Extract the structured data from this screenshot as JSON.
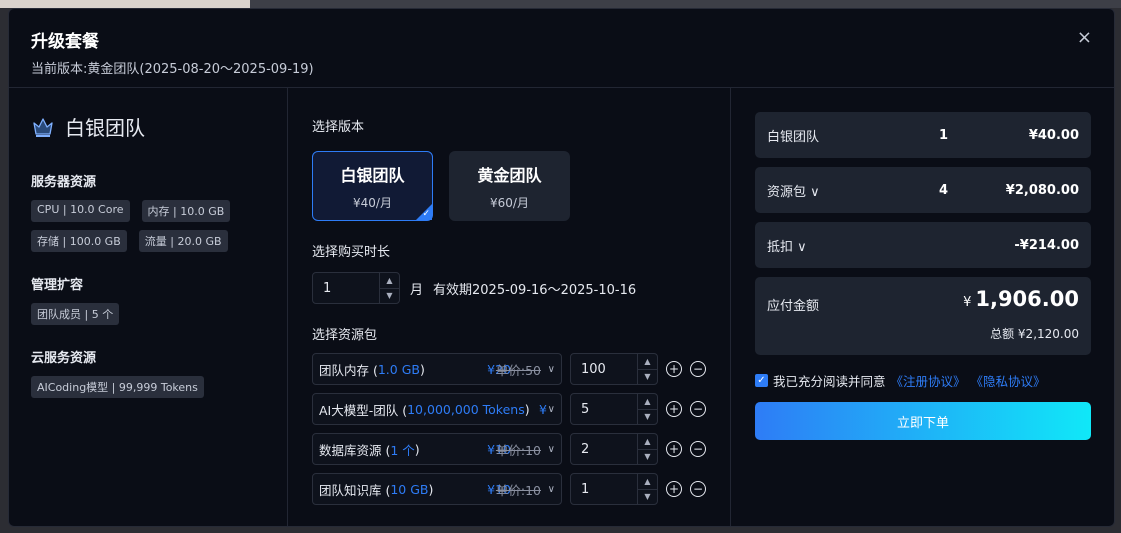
{
  "modal": {
    "title": "升级套餐",
    "subtitle": "当前版本:黄金团队(2025-08-20～2025-09-19)",
    "close_icon": "×"
  },
  "plan": {
    "name": "白银团队",
    "icon": "crown-icon",
    "sections": [
      {
        "title": "服务器资源",
        "tags": [
          "CPU | 10.0 Core",
          "内存 | 10.0 GB",
          "存储 | 100.0 GB",
          "流量 | 20.0 GB"
        ]
      },
      {
        "title": "管理扩容",
        "tags": [
          "团队成员 | 5 个"
        ]
      },
      {
        "title": "云服务资源",
        "tags": [
          "AICoding模型 | 99,999 Tokens"
        ]
      }
    ]
  },
  "version": {
    "label": "选择版本",
    "options": [
      {
        "name": "白银团队",
        "price": "¥40/月",
        "selected": true
      },
      {
        "name": "黄金团队",
        "price": "¥60/月",
        "selected": false
      }
    ]
  },
  "duration": {
    "label": "选择购买时长",
    "value": "1",
    "unit": "月",
    "validity": "有效期2025-09-16～2025-10-16"
  },
  "resources": {
    "label": "选择资源包",
    "items": [
      {
        "name": "团队内存 (",
        "spec": "1.0 GB",
        "close": ")",
        "price": "¥20",
        "old": "单价:50",
        "qty": "100"
      },
      {
        "name": "AI大模型-团队 (",
        "spec": "10,000,000 Tokens",
        "close": ")",
        "price": "¥",
        "old": "",
        "qty": "5"
      },
      {
        "name": "数据库资源 (",
        "spec": "1 个",
        "close": ")",
        "price": "¥10",
        "old": "单价:10",
        "qty": "2"
      },
      {
        "name": "团队知识库 (",
        "spec": "10 GB",
        "close": ")",
        "price": "¥10",
        "old": "单价:10",
        "qty": "1"
      }
    ]
  },
  "summary": {
    "rows": [
      {
        "label": "白银团队",
        "qty": "1",
        "amount": "¥40.00"
      },
      {
        "label": "资源包 ∨",
        "qty": "4",
        "amount": "¥2,080.00"
      },
      {
        "label": "抵扣 ∨",
        "qty": "",
        "amount": "-¥214.00"
      }
    ],
    "pay_label": "应付金额",
    "pay_currency": "¥",
    "pay_amount": "1,906.00",
    "total_text": "总额  ¥2,120.00"
  },
  "agreement": {
    "text": "我已充分阅读并同意",
    "link1": "《注册协议》",
    "link2": "《隐私协议》"
  },
  "order_button": "立即下单"
}
